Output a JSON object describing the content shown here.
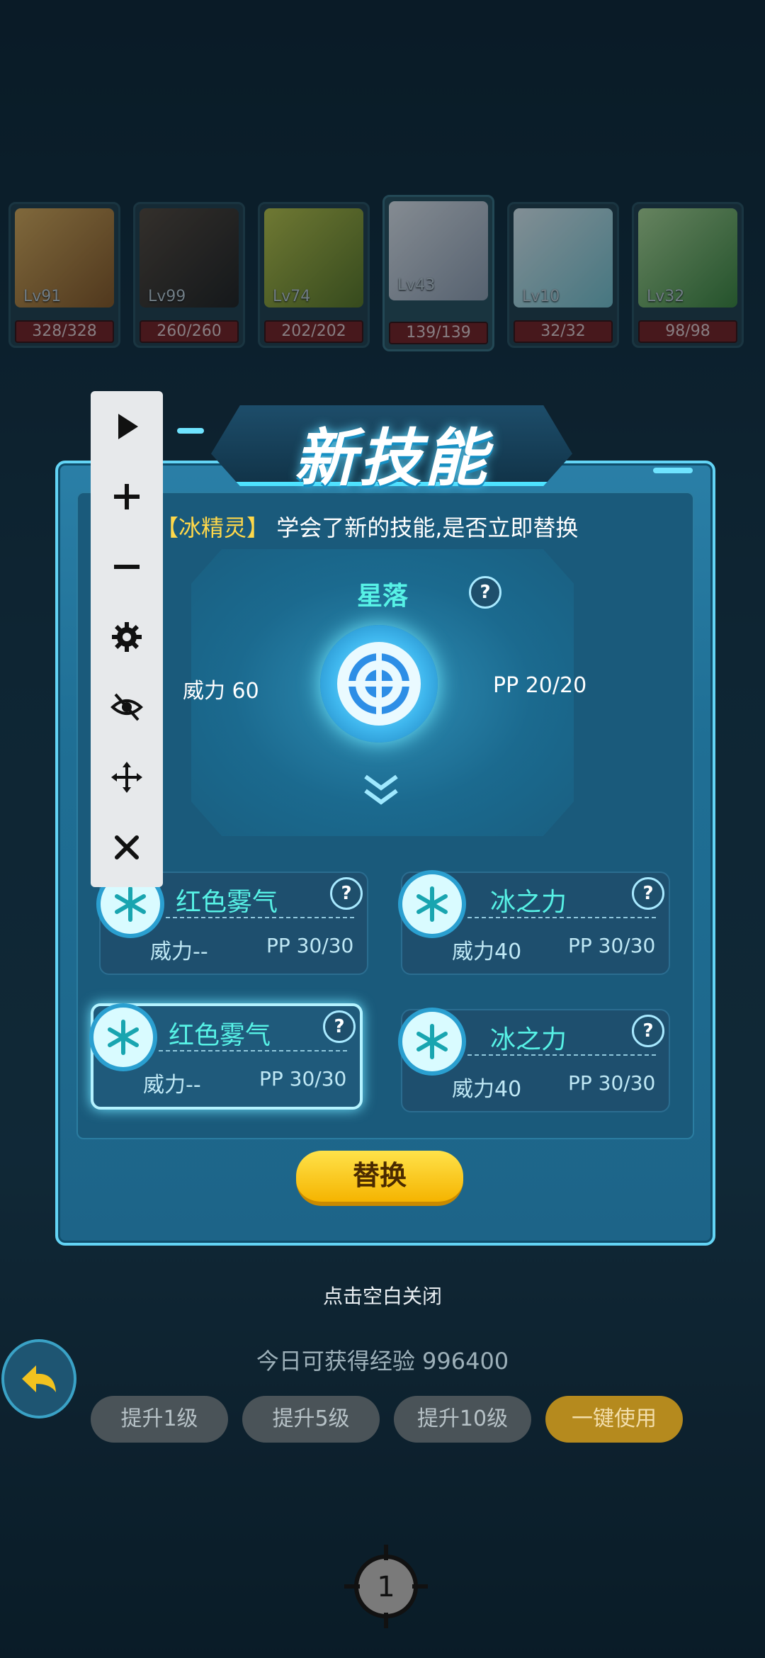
{
  "pets": [
    {
      "level": "Lv91",
      "hp": "328/328",
      "color": "#c08a3a"
    },
    {
      "level": "Lv99",
      "hp": "260/260",
      "color": "#4a3a2e"
    },
    {
      "level": "Lv74",
      "hp": "202/202",
      "color": "#9aa83a"
    },
    {
      "level": "Lv43",
      "hp": "139/139",
      "color": "#d6dce6",
      "selected": true
    },
    {
      "level": "Lv10",
      "hp": "32/32",
      "color": "#c8e8ee"
    },
    {
      "level": "Lv32",
      "hp": "98/98",
      "color": "#6fbf5c"
    }
  ],
  "dialog": {
    "title": "新技能",
    "prompt_name": "【冰精灵】",
    "prompt_text": "学会了新的技能,是否立即替换",
    "new_skill": {
      "name": "星落",
      "power": "威力 60",
      "pp": "PP 20/20",
      "help": "?"
    },
    "skills": [
      {
        "name": "红色雾气",
        "power": "威力--",
        "pp": "PP 30/30",
        "help": "?"
      },
      {
        "name": "冰之力",
        "power": "威力40",
        "pp": "PP 30/30",
        "help": "?"
      },
      {
        "name": "红色雾气",
        "power": "威力--",
        "pp": "PP 30/30",
        "help": "?",
        "selected": true
      },
      {
        "name": "冰之力",
        "power": "威力40",
        "pp": "PP 30/30",
        "help": "?"
      }
    ],
    "replace_label": "替换"
  },
  "close_tip": "点击空白关闭",
  "exp_text": "今日可获得经验 996400",
  "level_buttons": [
    "提升1级",
    "提升5级",
    "提升10级",
    "一键使用"
  ],
  "toolbar": [
    "play-icon",
    "plus-icon",
    "minus-icon",
    "gear-icon",
    "eye-off-icon",
    "move-icon",
    "close-icon"
  ],
  "colors": {
    "accent": "#57f2e6",
    "gold": "#ffd84a",
    "frame": "#63d4f5"
  },
  "crosshair_label": "1"
}
